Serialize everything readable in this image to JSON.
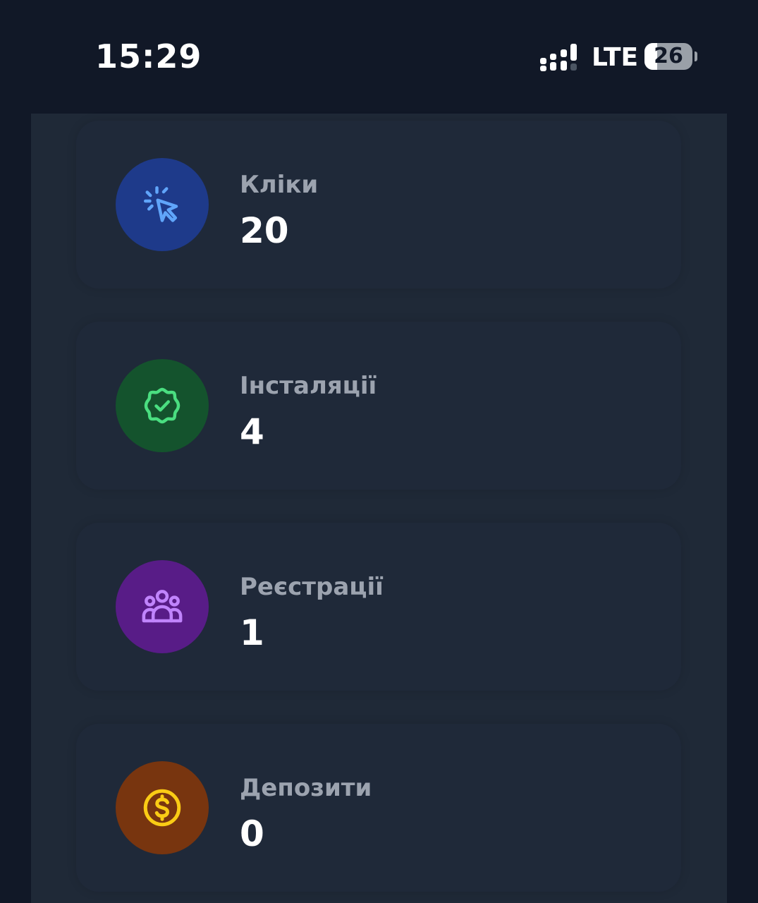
{
  "status_bar": {
    "time": "15:29",
    "network": "LTE",
    "battery_percent": "26",
    "battery_level": 0.26
  },
  "stats": [
    {
      "label": "Кліки",
      "value": "20",
      "icon": "cursor-click-icon",
      "circle_color": "#1e3a8a",
      "icon_color": "#60a5fa"
    },
    {
      "label": "Інсталяції",
      "value": "4",
      "icon": "badge-check-icon",
      "circle_color": "#14532d",
      "icon_color": "#4ade80"
    },
    {
      "label": "Реєстрації",
      "value": "1",
      "icon": "user-group-icon",
      "circle_color": "#581c87",
      "icon_color": "#c084fc"
    },
    {
      "label": "Депозити",
      "value": "0",
      "icon": "dollar-coin-icon",
      "circle_color": "#78350f",
      "icon_color": "#facc15"
    }
  ]
}
